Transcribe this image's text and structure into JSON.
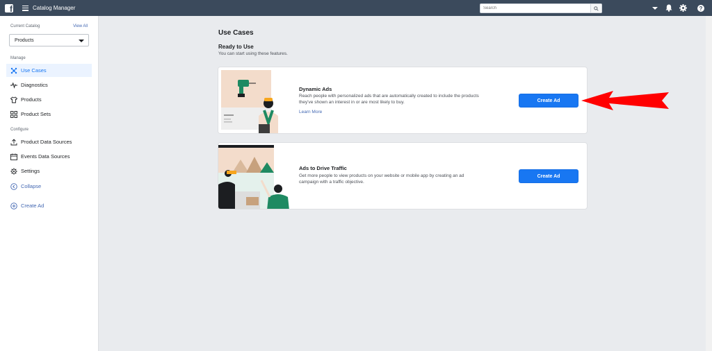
{
  "topbar": {
    "logo_letter": "f",
    "app_title": "Catalog Manager",
    "search_placeholder": "Search",
    "icons": [
      "dropdown-caret-icon",
      "notification-bell-icon",
      "gear-icon",
      "help-icon"
    ]
  },
  "sidebar": {
    "current_catalog_label": "Current Catalog",
    "view_all_label": "View All",
    "catalog_selected": "Products",
    "manage_label": "Manage",
    "manage_items": [
      {
        "label": "Use Cases",
        "icon": "use-cases-icon"
      },
      {
        "label": "Diagnostics",
        "icon": "pulse-icon"
      },
      {
        "label": "Products",
        "icon": "shirt-icon"
      },
      {
        "label": "Product Sets",
        "icon": "grid-icon"
      }
    ],
    "configure_label": "Configure",
    "configure_items": [
      {
        "label": "Product Data Sources",
        "icon": "upload-icon"
      },
      {
        "label": "Events Data Sources",
        "icon": "calendar-icon"
      },
      {
        "label": "Settings",
        "icon": "gear-icon"
      },
      {
        "label": "Collapse",
        "icon": "collapse-icon"
      }
    ],
    "create_ad_label": "Create Ad"
  },
  "main": {
    "title": "Use Cases",
    "ready_title": "Ready to Use",
    "ready_desc": "You can start using these features.",
    "cards": [
      {
        "title": "Dynamic Ads",
        "desc_line1": "Reach people with personalized ads that are automatically created to include the products",
        "desc_line2": "they've shown an interest in or are most likely to buy.",
        "link": "Learn More",
        "button": "Create Ad"
      },
      {
        "title": "Ads to Drive Traffic",
        "desc_line1": "Get more people to view products on your website or mobile app by creating an ad",
        "desc_line2": "campaign with a traffic objective.",
        "button": "Create Ad"
      }
    ]
  },
  "colors": {
    "topbar": "#3b4a5c",
    "accent": "#1877f2",
    "link": "#4267b2",
    "arrow": "#ff0000"
  }
}
